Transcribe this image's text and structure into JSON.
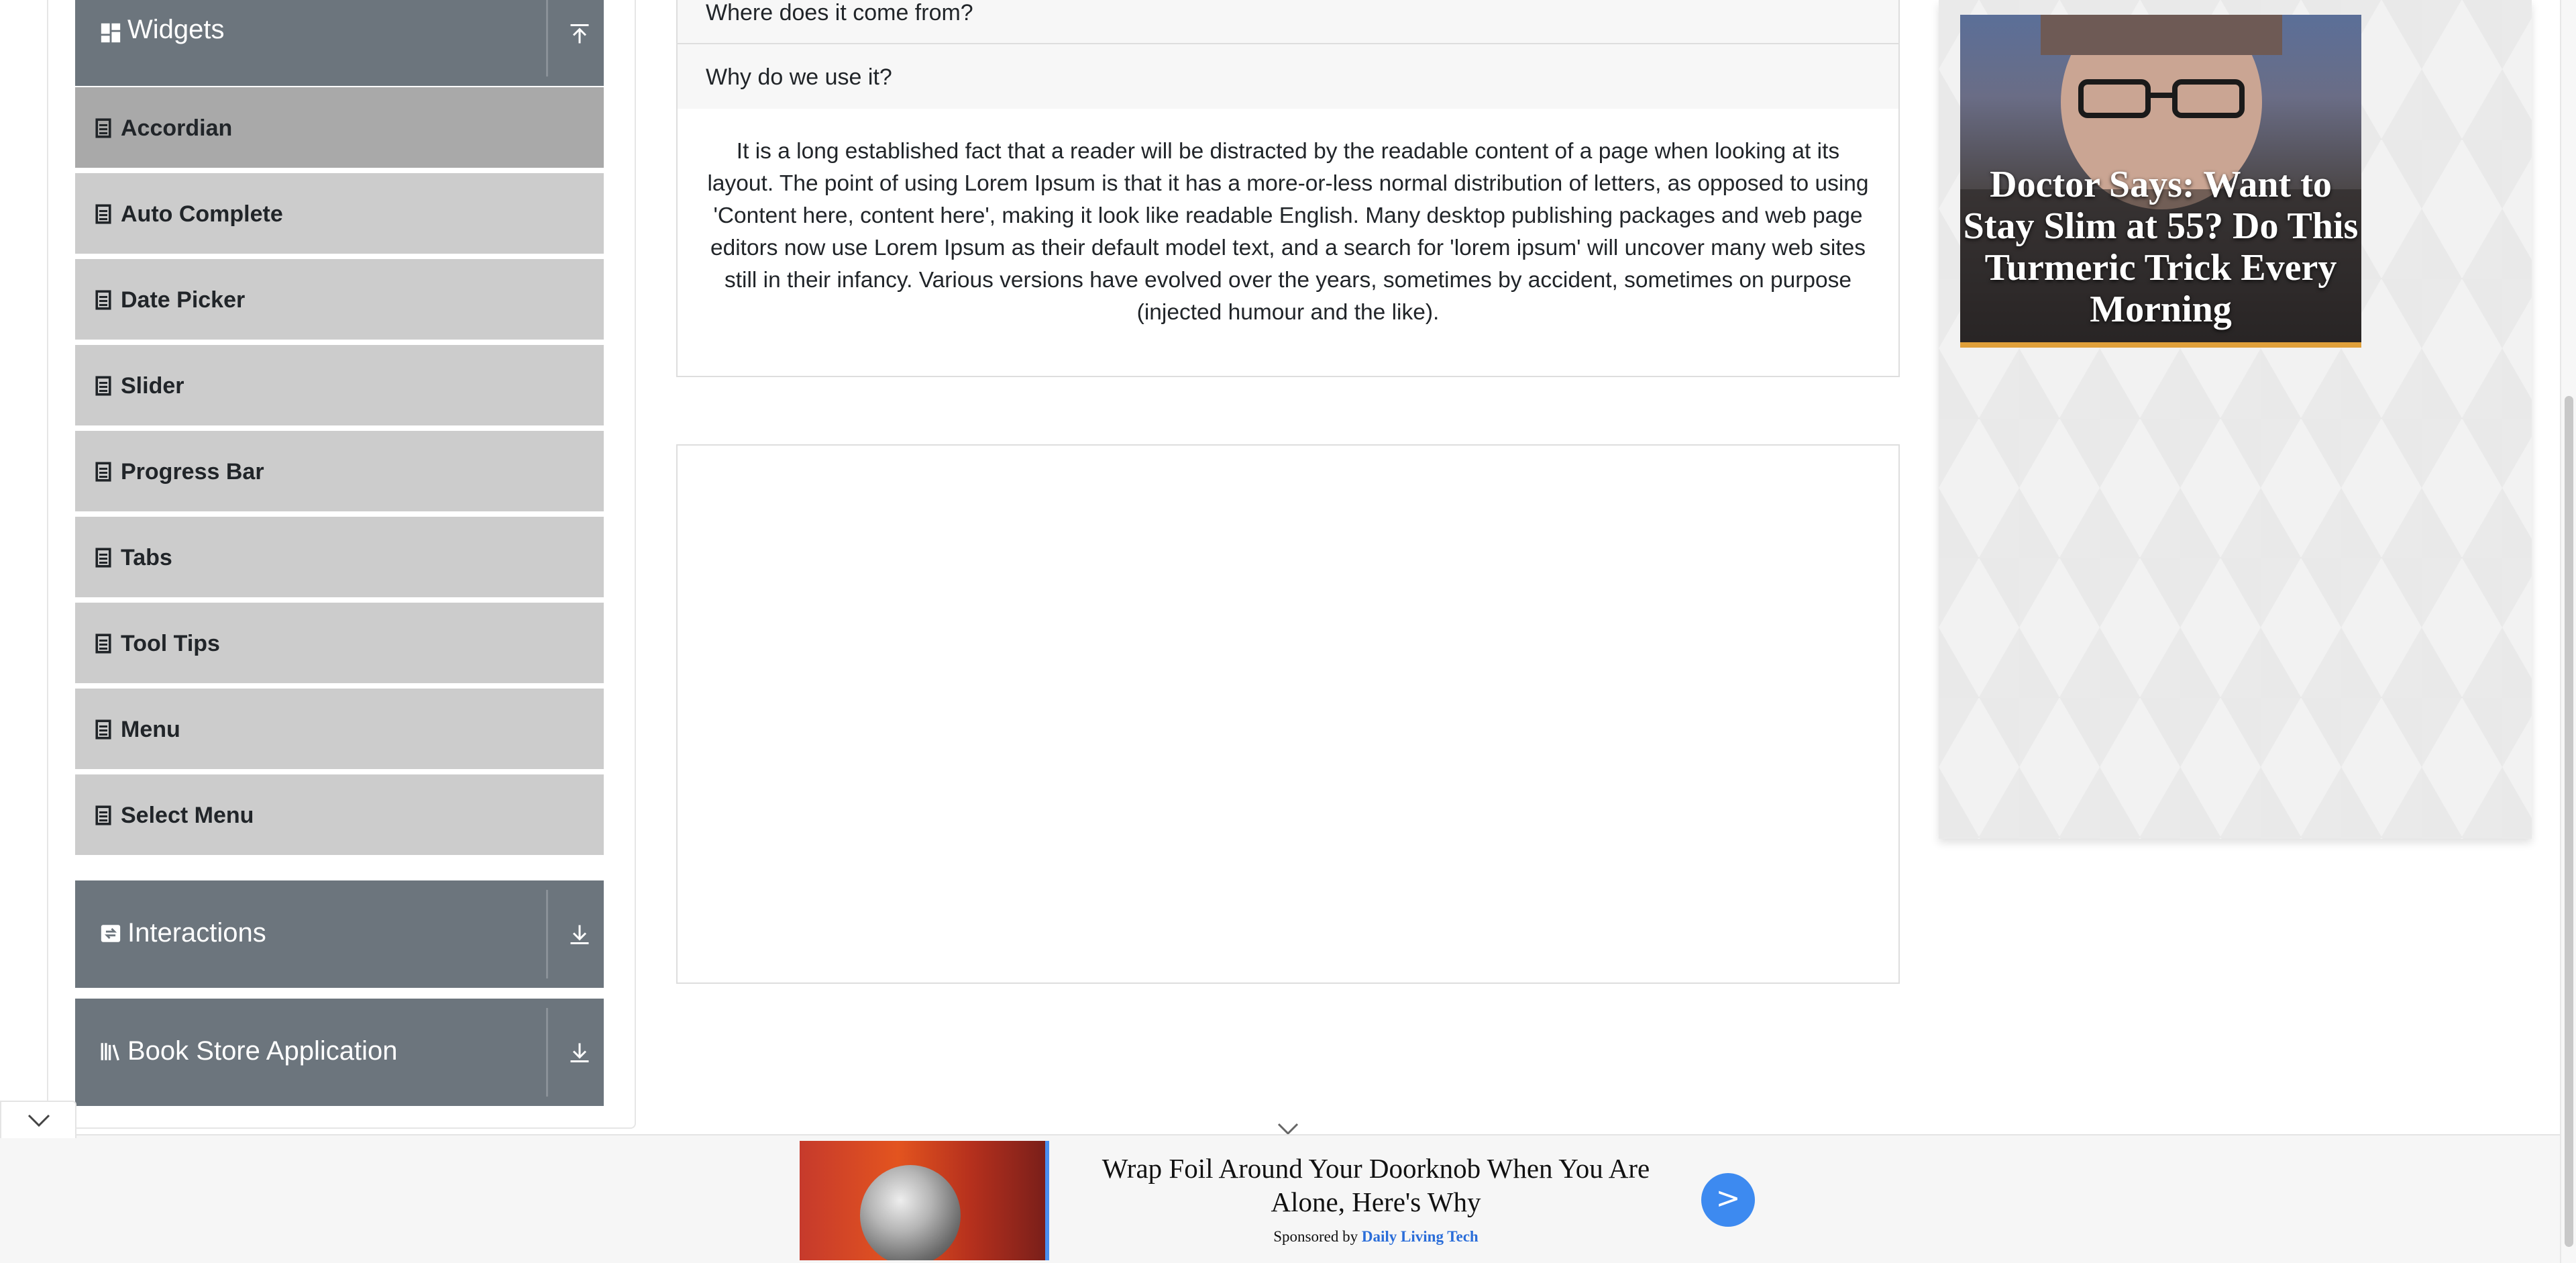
{
  "sidebar": {
    "widgets_header": {
      "title": "Widgets",
      "icon": "widgets-grid-icon",
      "toggle_icon": "collapse-up-icon"
    },
    "items": [
      {
        "label": "Accordian",
        "active": true
      },
      {
        "label": "Auto Complete"
      },
      {
        "label": "Date Picker"
      },
      {
        "label": "Slider"
      },
      {
        "label": "Progress Bar"
      },
      {
        "label": "Tabs"
      },
      {
        "label": "Tool Tips"
      },
      {
        "label": "Menu"
      },
      {
        "label": "Select Menu"
      }
    ],
    "item_icon": "document-icon",
    "interactions_header": {
      "title": "Interactions",
      "icon": "interactions-icon",
      "toggle_icon": "expand-down-icon"
    },
    "bookstore_header": {
      "title": "Book Store Application",
      "icon": "books-icon",
      "toggle_icon": "expand-down-icon"
    }
  },
  "accordion": {
    "section2_title": "Where does it come from?",
    "section3_title": "Why do we use it?",
    "section3_body": "It is a long established fact that a reader will be distracted by the readable content of a page when looking at its layout. The point of using Lorem Ipsum is that it has a more-or-less normal distribution of letters, as opposed to using 'Content here, content here', making it look like readable English. Many desktop publishing packages and web page editors now use Lorem Ipsum as their default model text, and a search for 'lorem ipsum' will uncover many web sites still in their infancy. Various versions have evolved over the years, sometimes by accident, sometimes on purpose (injected humour and the like)."
  },
  "side_ad": {
    "headline": "Doctor Says: Want to Stay Slim at 55? Do This Turmeric Trick Every Morning"
  },
  "bottom_ad": {
    "headline": "Wrap Foil Around Your Doorknob When You Are Alone, Here's Why",
    "sponsored_prefix": "Sponsored by",
    "sponsor": "Daily Living Tech",
    "cta": ">"
  },
  "colors": {
    "group_header_bg": "#6c757d",
    "menu_item_bg": "#cccccc",
    "menu_item_active_bg": "#a9a9a9",
    "cta_blue": "#3d8af0"
  }
}
